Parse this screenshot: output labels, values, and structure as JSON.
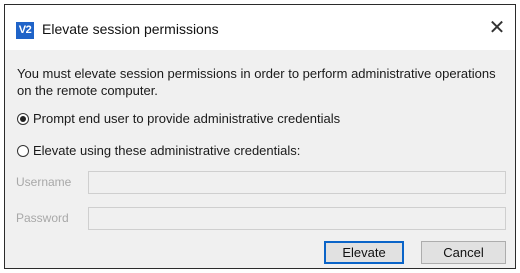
{
  "window": {
    "title": "Elevate session permissions",
    "icon_text": "V2",
    "close_glyph": "✕"
  },
  "message": "You must elevate session permissions in order to perform administrative operations on the remote computer.",
  "options": [
    {
      "label": "Prompt end user to provide administrative credentials",
      "selected": true
    },
    {
      "label": "Elevate using these administrative credentials:",
      "selected": false
    }
  ],
  "fields": {
    "username_label": "Username",
    "password_label": "Password",
    "username_value": "",
    "password_value": ""
  },
  "buttons": {
    "elevate": "Elevate",
    "cancel": "Cancel"
  },
  "colors": {
    "accent": "#1f63c8",
    "disabled_text": "#a8a8a8"
  }
}
